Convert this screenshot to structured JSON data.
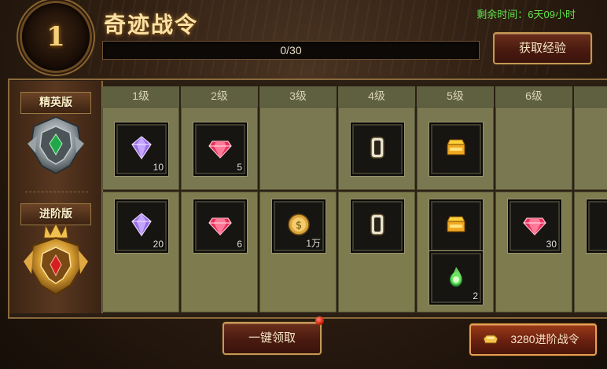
{
  "header": {
    "level": "1",
    "title": "奇迹战令",
    "remaining_time": "剩余时间：6天09小时",
    "progress_text": "0/30",
    "progress_fraction": 0,
    "get_exp_label": "获取经验"
  },
  "tiers": {
    "elite_label": "精英版",
    "advanced_label": "进阶版"
  },
  "levels": [
    "1级",
    "2级",
    "3级",
    "4级",
    "5级",
    "6级"
  ],
  "elite_rewards": [
    {
      "icon": "purple-gem-icon",
      "qty": "10"
    },
    {
      "icon": "red-gem-icon",
      "qty": "5"
    },
    null,
    {
      "icon": "scroll-icon",
      "qty": ""
    },
    {
      "icon": "gold-chest-icon",
      "qty": ""
    },
    null
  ],
  "advanced_rewards": [
    [
      {
        "icon": "purple-gem-icon",
        "qty": "20"
      }
    ],
    [
      {
        "icon": "red-gem-icon",
        "qty": "6"
      }
    ],
    [
      {
        "icon": "gold-coin-icon",
        "qty": "1万"
      }
    ],
    [
      {
        "icon": "scroll-icon",
        "qty": ""
      }
    ],
    [
      {
        "icon": "gold-chest-icon",
        "qty": ""
      },
      {
        "icon": "green-flame-icon",
        "qty": "2"
      }
    ],
    [
      {
        "icon": "red-gem-icon",
        "qty": "30"
      }
    ]
  ],
  "footer": {
    "claim_all_label": "一键领取",
    "advanced_buy_label": "3280进阶战令"
  },
  "colors": {
    "remaining_text": "#5fe34a",
    "title_gold": "#fbe2a4",
    "cell_olive": "#77754a"
  }
}
